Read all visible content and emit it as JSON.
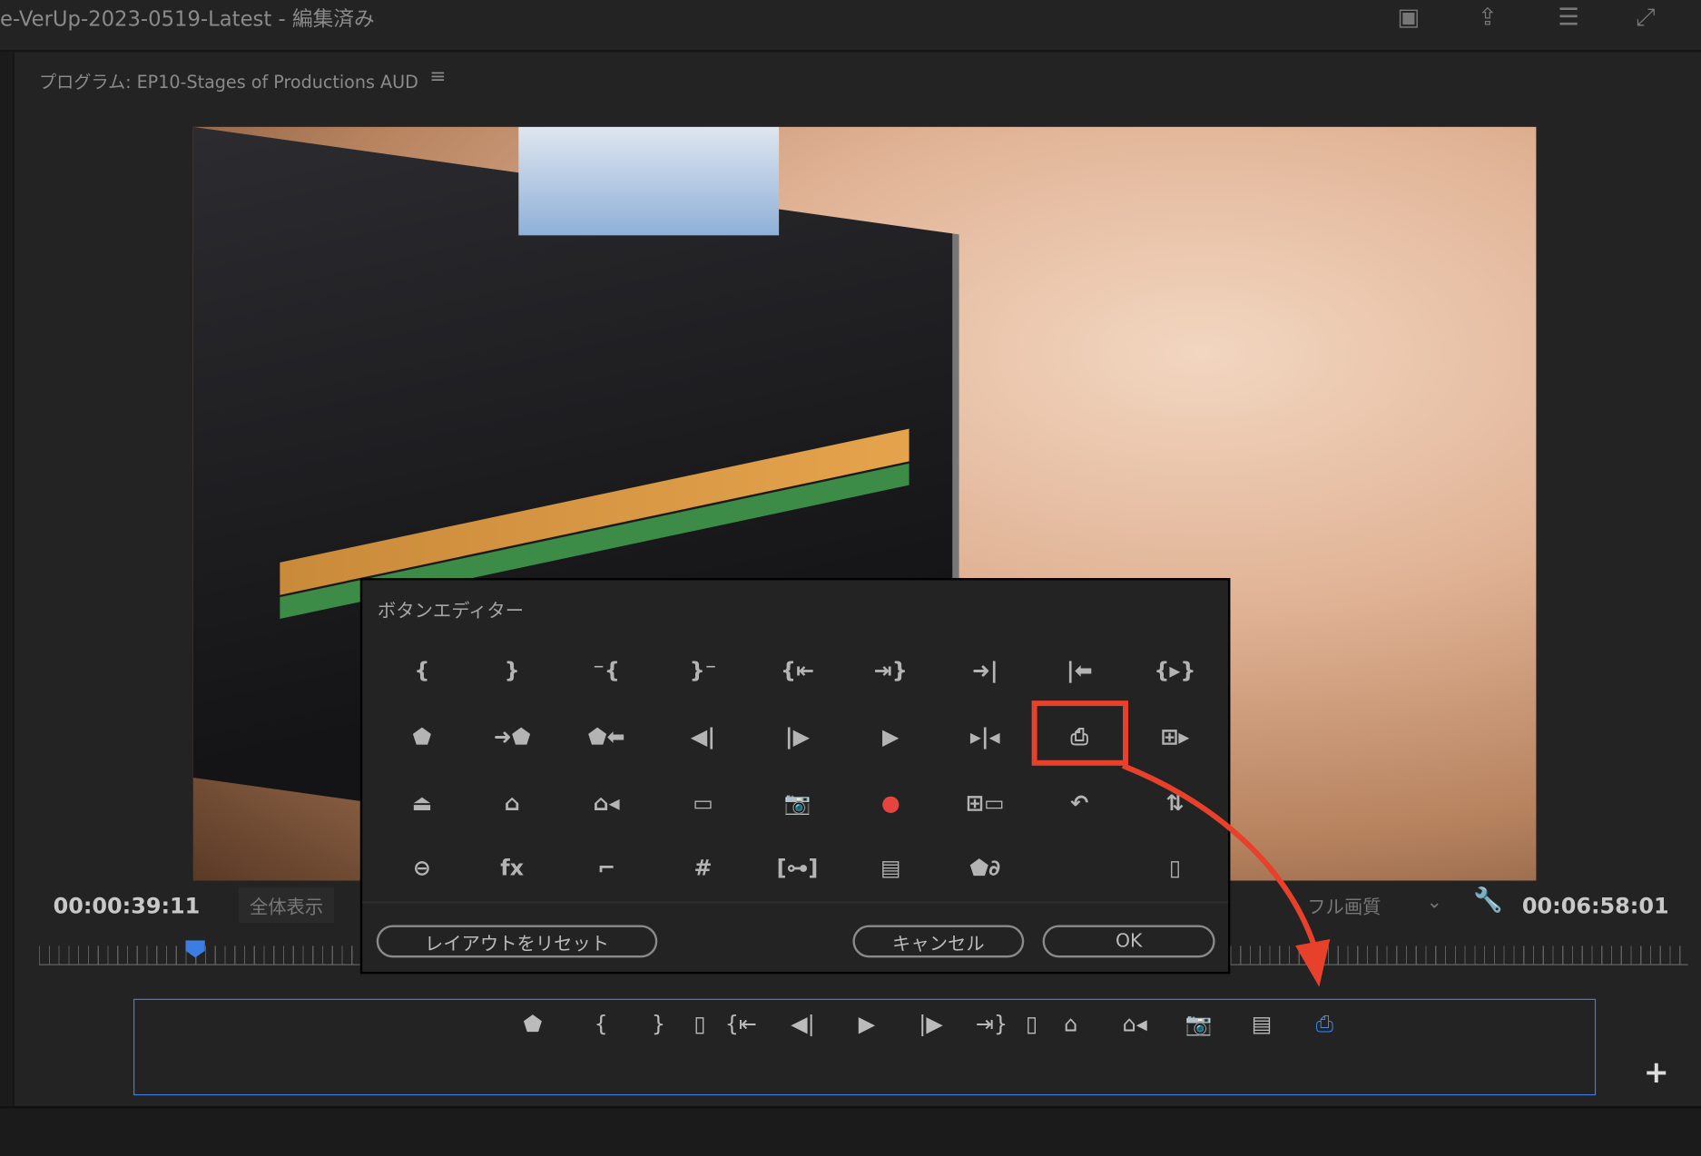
{
  "window": {
    "title": "e-VerUp-2023-0519-Latest - 編集済み"
  },
  "panel": {
    "title": "プログラム: EP10-Stages of Productions AUD",
    "menu_icon": "≡"
  },
  "monitor": {
    "current_timecode": "00:00:39:11",
    "zoom_select": "全体表示",
    "quality_select": "フル画質",
    "duration_timecode": "00:06:58:01",
    "playhead_position_fraction": 0.095
  },
  "dialog": {
    "title": "ボタンエディター",
    "icons": [
      [
        "{",
        "}",
        "⁻{",
        "}⁻",
        "{⇤",
        "⇥}",
        "➜|",
        "|⬅",
        "{▸}"
      ],
      [
        "⬟",
        "➜⬟",
        "⬟⬅",
        "◀|",
        "|▶",
        "▶",
        "▸|◂",
        "⎙",
        "⊞▸"
      ],
      [
        "⏏",
        "⌂",
        "⌂◂",
        "▭",
        "📷",
        "●",
        "⊞▭",
        "↶",
        "⇅"
      ],
      [
        "⊖",
        "fx",
        "⌐",
        "#",
        "[⊶]",
        "▤",
        "⬟∂",
        "",
        "▯"
      ]
    ],
    "reset_label": "レイアウトをリセット",
    "cancel_label": "キャンセル",
    "ok_label": "OK"
  },
  "button_bar": {
    "icons": [
      "⬟",
      "{",
      "}",
      "▯",
      "{⇤",
      "◀|",
      "▶",
      "|▶",
      "⇥}",
      "▯",
      "⌂",
      "⌂◂",
      "📷",
      "▤",
      "⎙"
    ],
    "add_label": "+"
  },
  "colors": {
    "accent": "#3d7de0",
    "highlight": "#e8412b",
    "record": "#e5443f"
  }
}
